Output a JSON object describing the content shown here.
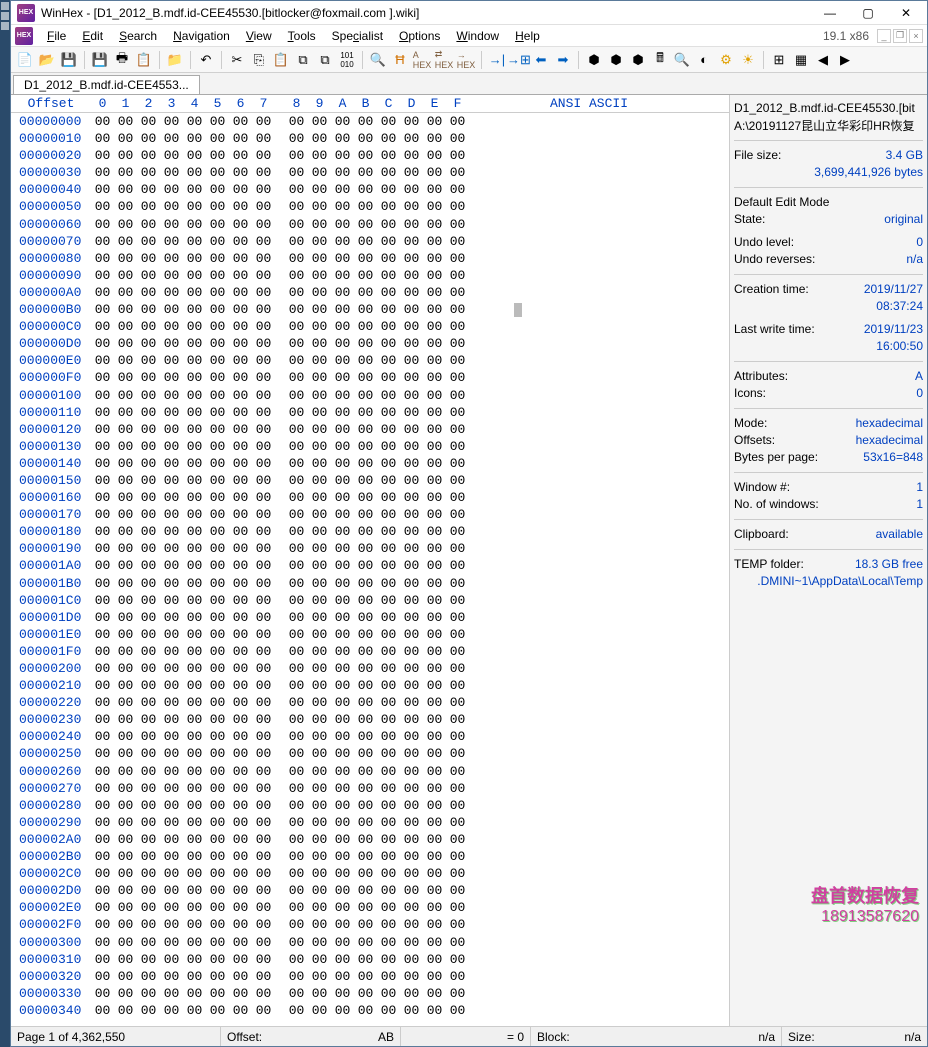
{
  "title": "WinHex - [D1_2012_B.mdf.id-CEE45530.[bitlocker@foxmail.com ].wiki]",
  "version": "19.1 x86",
  "menus": [
    "File",
    "Edit",
    "Search",
    "Navigation",
    "View",
    "Tools",
    "Specialist",
    "Options",
    "Window",
    "Help"
  ],
  "tab": "D1_2012_B.mdf.id-CEE4553...",
  "hex": {
    "offset_label": "Offset",
    "cols": [
      "0",
      "1",
      "2",
      "3",
      "4",
      "5",
      "6",
      "7",
      "8",
      "9",
      "A",
      "B",
      "C",
      "D",
      "E",
      "F"
    ],
    "ascii_label": "ANSI ASCII",
    "rows": 53,
    "byte": "00"
  },
  "side": {
    "filename": "D1_2012_B.mdf.id-CEE45530.[bit",
    "filepath": "A:\\20191127昆山立华彩印HR恢复",
    "filesize_lbl": "File size:",
    "filesize": "3.4 GB",
    "filesize_bytes": "3,699,441,926 bytes",
    "editmode_lbl": "Default Edit Mode",
    "state_lbl": "State:",
    "state": "original",
    "undolevel_lbl": "Undo level:",
    "undolevel": "0",
    "undorev_lbl": "Undo reverses:",
    "undorev": "n/a",
    "ctime_lbl": "Creation time:",
    "ctime": "2019/11/27",
    "ctime2": "08:37:24",
    "wtime_lbl": "Last write time:",
    "wtime": "2019/11/23",
    "wtime2": "16:00:50",
    "attr_lbl": "Attributes:",
    "attr": "A",
    "icons_lbl": "Icons:",
    "icons": "0",
    "mode_lbl": "Mode:",
    "mode": "hexadecimal",
    "offsets_lbl": "Offsets:",
    "offsets": "hexadecimal",
    "bpp_lbl": "Bytes per page:",
    "bpp": "53x16=848",
    "winnum_lbl": "Window #:",
    "winnum": "1",
    "wincount_lbl": "No. of windows:",
    "wincount": "1",
    "clip_lbl": "Clipboard:",
    "clip": "available",
    "temp_lbl": "TEMP folder:",
    "temp": "18.3 GB free",
    "temppath": ".DMINI~1\\AppData\\Local\\Temp"
  },
  "watermark": {
    "line1": "盘首数据恢复",
    "line2": "18913587620"
  },
  "status": {
    "page": "Page 1 of 4,362,550",
    "offset_lbl": "Offset:",
    "offset_val": "AB",
    "eq": "= 0",
    "block_lbl": "Block:",
    "block_val": "n/a",
    "size_lbl": "Size:",
    "size_val": "n/a"
  }
}
